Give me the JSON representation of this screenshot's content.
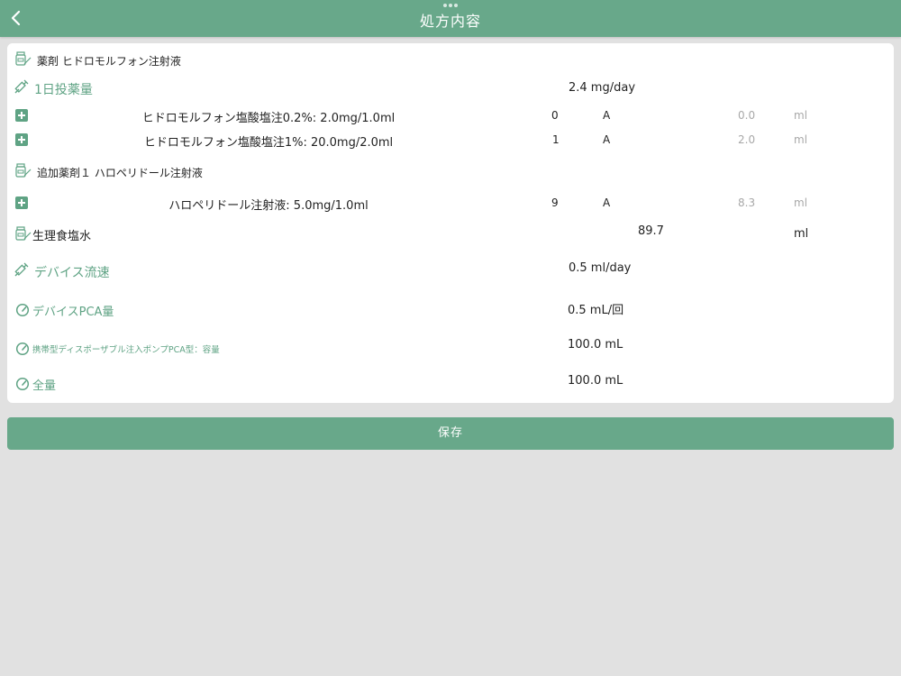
{
  "header": {
    "title": "処方内容",
    "back_icon": "chevron-left-icon",
    "background": "#68a88a"
  },
  "drug": {
    "title": "薬剤 ヒドロモルフォン注射液",
    "icon": "medicine-bottle-icon"
  },
  "daily_dose": {
    "label": "1日投薬量",
    "icon": "syringe-icon",
    "value": "2.4 mg/day"
  },
  "ingredients": [
    {
      "name": "ヒドロモルフォン塩酸塩注0.2%: 2.0mg/1.0ml",
      "qty": "0",
      "unit": "A",
      "volume": "0.0",
      "vol_unit": "ml"
    },
    {
      "name": "ヒドロモルフォン塩酸塩注1%: 20.0mg/2.0ml",
      "qty": "1",
      "unit": "A",
      "volume": "2.0",
      "vol_unit": "ml"
    }
  ],
  "additional_drug": {
    "title": "追加薬剤１ ハロペリドール注射液",
    "icon": "medicine-bottle-icon",
    "ingredient": {
      "name": "ハロペリドール注射液: 5.0mg/1.0ml",
      "qty": "9",
      "unit": "A",
      "volume": "8.3",
      "vol_unit": "ml"
    }
  },
  "saline": {
    "label": "生理食塩水",
    "icon": "medicine-bottle-icon",
    "value": "89.7",
    "unit": "ml"
  },
  "device_flow": {
    "label": "デバイス流速",
    "icon": "syringe-icon",
    "value": "0.5 ml/day"
  },
  "device_pca": {
    "label": "デバイスPCA量",
    "icon": "gauge-icon",
    "value": "0.5 mL/回"
  },
  "pump_capacity": {
    "label": "携帯型ディスポーザブル注入ポンプPCA型：容量",
    "icon": "gauge-icon",
    "value": "100.0 mL"
  },
  "total": {
    "label": "全量",
    "icon": "gauge-icon",
    "value": "100.0 mL"
  },
  "save_button": {
    "label": "保存"
  },
  "colors": {
    "accent": "#68a88a",
    "label_green": "#5fa384",
    "background": "#e1e1e1"
  }
}
